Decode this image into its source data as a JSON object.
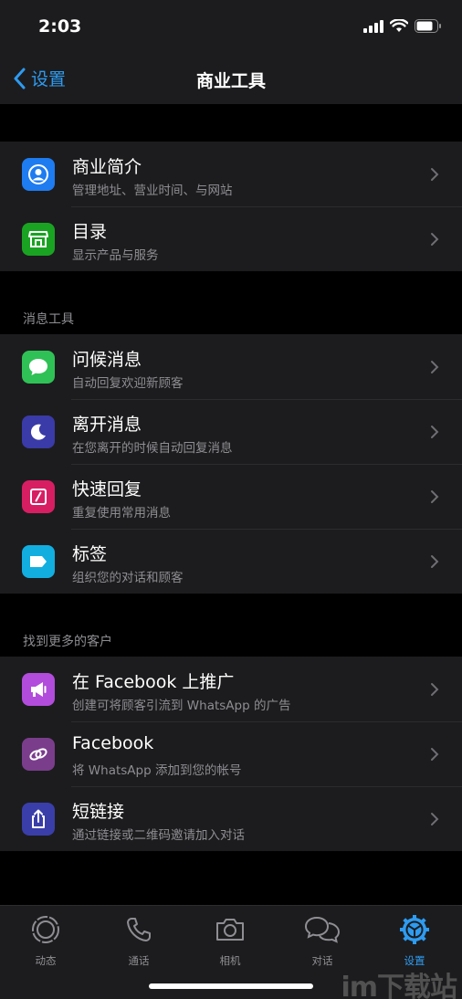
{
  "status_bar": {
    "time": "2:03"
  },
  "nav": {
    "back_label": "设置",
    "title": "商业工具"
  },
  "groups": [
    {
      "header": "",
      "items": [
        {
          "title": "商业简介",
          "subtitle": "管理地址、营业时间、与网站",
          "icon": "storefront-profile-icon",
          "color": "#1e7cf0"
        },
        {
          "title": "目录",
          "subtitle": "显示产品与服务",
          "icon": "catalog-shop-icon",
          "color": "#1aa322"
        }
      ]
    },
    {
      "header": "消息工具",
      "items": [
        {
          "title": "问候消息",
          "subtitle": "自动回复欢迎新顾客",
          "icon": "chat-bubble-icon",
          "color": "#30c156"
        },
        {
          "title": "离开消息",
          "subtitle": "在您离开的时候自动回复消息",
          "icon": "moon-icon",
          "color": "#3a3aa8"
        },
        {
          "title": "快速回复",
          "subtitle": "重复使用常用消息",
          "icon": "quick-reply-icon",
          "color": "#d81e63"
        },
        {
          "title": "标签",
          "subtitle": "组织您的对话和顾客",
          "icon": "label-tag-icon",
          "color": "#12aee0"
        }
      ]
    },
    {
      "header": "找到更多的客户",
      "items": [
        {
          "title": "在 Facebook 上推广",
          "subtitle": "创建可将顾客引流到 WhatsApp 的广告",
          "icon": "megaphone-icon",
          "color": "#b24cdc"
        },
        {
          "title": "Facebook",
          "subtitle": "将 WhatsApp 添加到您的帐号",
          "icon": "link-rings-icon",
          "color": "#7a3d8c"
        },
        {
          "title": "短链接",
          "subtitle": "通过链接或二维码邀请加入对话",
          "icon": "share-icon",
          "color": "#3a3ea8"
        }
      ]
    }
  ],
  "tabs": [
    {
      "label": "动态",
      "icon": "status-icon",
      "active": false
    },
    {
      "label": "通话",
      "icon": "phone-icon",
      "active": false
    },
    {
      "label": "相机",
      "icon": "camera-icon",
      "active": false
    },
    {
      "label": "对话",
      "icon": "chats-icon",
      "active": false
    },
    {
      "label": "设置",
      "icon": "settings-gear-icon",
      "active": true
    }
  ],
  "colors": {
    "accent": "#2e9bf0",
    "background": "#000000",
    "cell": "#1c1c1e",
    "secondary_text": "#8e8e93"
  },
  "watermark": "im下载站"
}
